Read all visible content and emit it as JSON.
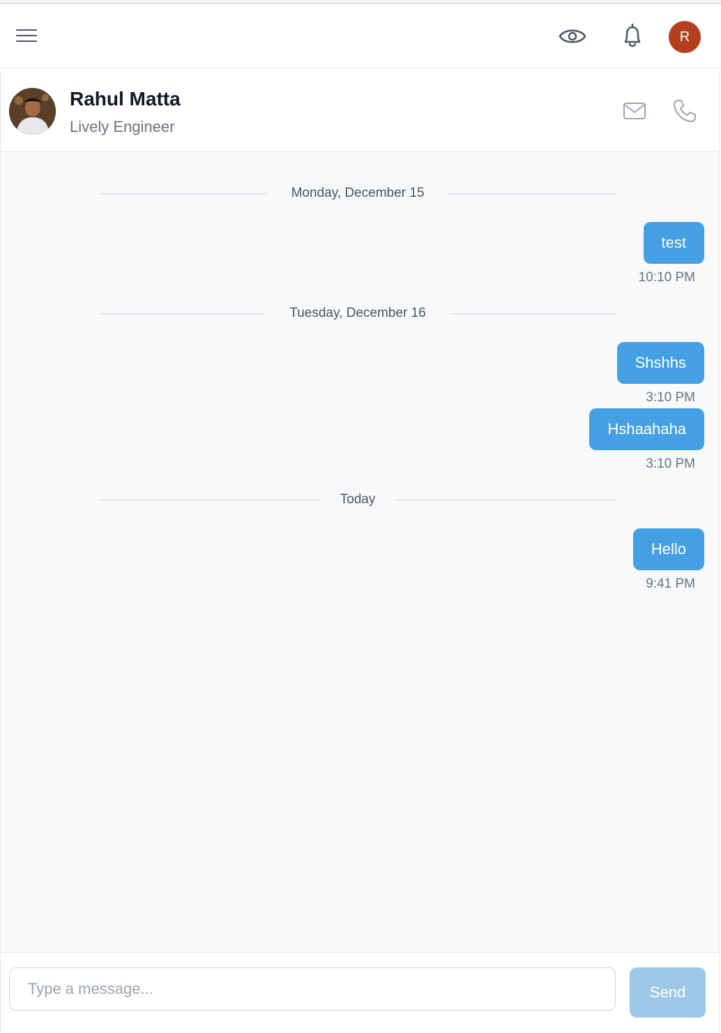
{
  "topbar": {
    "avatar_initial": "R",
    "avatar_color": "#b2401f"
  },
  "contact": {
    "name": "Rahul Matta",
    "title": "Lively Engineer"
  },
  "messages": {
    "groups": [
      {
        "date": "Monday, December 15",
        "items": [
          {
            "text": "test",
            "time": "10:10 PM"
          }
        ]
      },
      {
        "date": "Tuesday, December 16",
        "items": [
          {
            "text": "Shshhs",
            "time": "3:10 PM"
          },
          {
            "text": "Hshaahaha",
            "time": "3:10 PM"
          }
        ]
      },
      {
        "date": "Today",
        "items": [
          {
            "text": "Hello",
            "time": "9:41 PM"
          }
        ]
      }
    ]
  },
  "composer": {
    "placeholder": "Type a message...",
    "value": "",
    "send_label": "Send"
  },
  "colors": {
    "bubble": "#45a0e3",
    "send_disabled": "#9ec8e8",
    "background": "#f8f9fb"
  },
  "icons": [
    "menu-icon",
    "eye-icon",
    "bell-icon",
    "mail-icon",
    "phone-icon"
  ]
}
